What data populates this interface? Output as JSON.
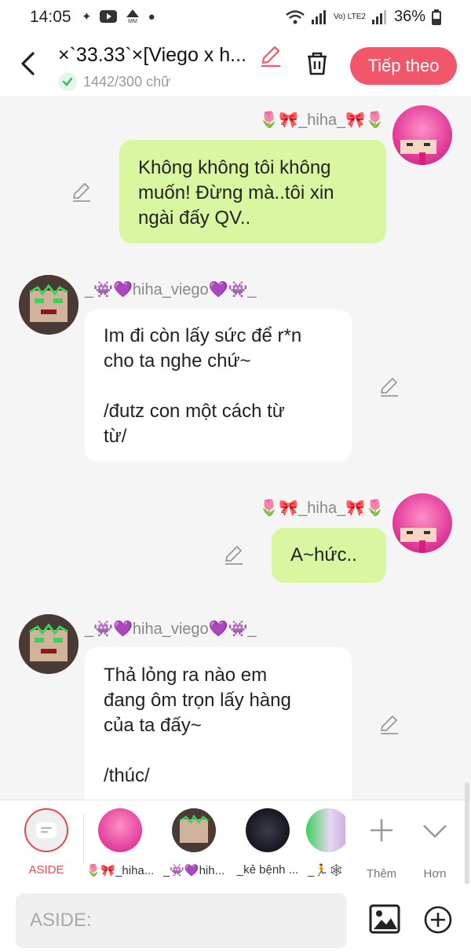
{
  "status_bar": {
    "time": "14:05",
    "network": "Vo) LTE2",
    "battery": "36%"
  },
  "header": {
    "title": "×`33.33`×[Viego x h...",
    "word_count": "1442/300 chữ",
    "next_label": "Tiếp theo"
  },
  "accent_color": "#f2566b",
  "messages": [
    {
      "sender": "🌷🎀_hiha_🎀🌷",
      "side": "right",
      "text": "Không không tôi không\nmuốn! Đừng mà..tôi xin\nngài đấy QV.."
    },
    {
      "sender": "_👾💜hiha_viego💜👾_",
      "side": "left",
      "text": "Im đi còn lấy sức để r*n\ncho ta nghe chứ~\n\n/đutz con một cách từ\ntừ/"
    },
    {
      "sender": "🌷🎀_hiha_🎀🌷",
      "side": "right",
      "text": "A~hức.."
    },
    {
      "sender": "_👾💜hiha_viego💜👾_",
      "side": "left",
      "text": "Thả lỏng ra nào em\nđang ôm trọn lấy hàng\ncủa ta đấy~\n\n/thúc/"
    }
  ],
  "character_bar": {
    "aside_label": "ASIDE",
    "characters": [
      "🌷🎀_hiha...",
      "_👾💜hih...",
      "_kẻ bệnh ...",
      "_🏃🕸"
    ],
    "add_label": "Thêm",
    "more_label": "Hơn"
  },
  "input": {
    "placeholder": "ASIDE:"
  }
}
